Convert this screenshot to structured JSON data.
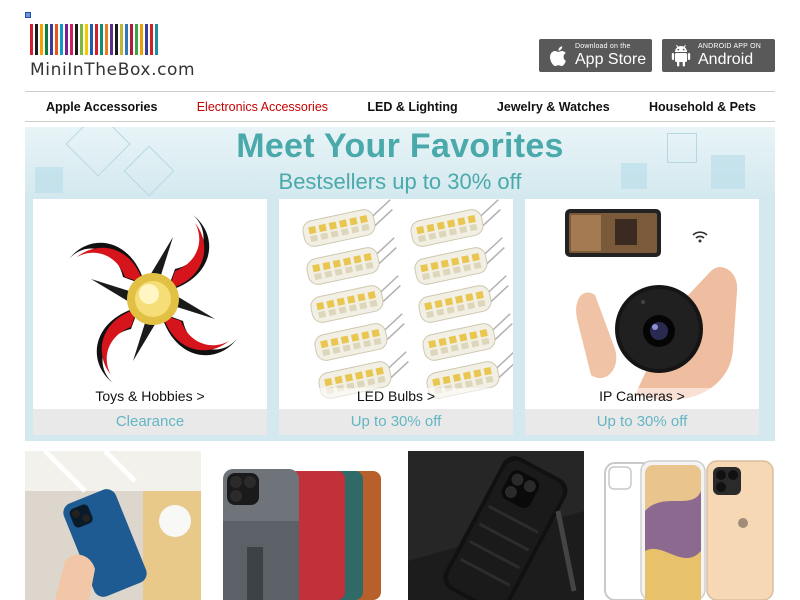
{
  "logo": {
    "text": "MiniInTheBox.com",
    "stripes": [
      "#d11f2e",
      "#1b1b1b",
      "#f3a200",
      "#0b7e3c",
      "#3b3b9c",
      "#e05a16",
      "#119ac9",
      "#7a1f8f",
      "#ce1f5b",
      "#1a1a1a",
      "#7cb93b",
      "#f2c800",
      "#1c5fa8",
      "#d11f2e",
      "#0f8d7c",
      "#e87b1e",
      "#5a2f8a",
      "#1b1b1b",
      "#c0b53a",
      "#2e7ab8",
      "#b3193b",
      "#3fa04a",
      "#e8a300",
      "#3b3b9c",
      "#cc2424",
      "#1c8ea3"
    ]
  },
  "badges": {
    "appstore": {
      "small": "Download on the",
      "big": "App Store",
      "icon": "apple-icon"
    },
    "android": {
      "small": "ANDROID APP ON",
      "big": "Android",
      "icon": "android-icon"
    }
  },
  "nav": {
    "items": [
      {
        "label": "Apple Accessories"
      },
      {
        "label": "Electronics Accessories"
      },
      {
        "label": "LED & Lighting"
      },
      {
        "label": "Jewelry & Watches"
      },
      {
        "label": "Household & Pets"
      }
    ],
    "active_index": 1
  },
  "banner": {
    "title": "Meet Your Favorites",
    "subtitle": "Bestsellers up to 30% off",
    "cards": [
      {
        "label": "Toys & Hobbies >",
        "promo": "Clearance",
        "image": "fidget-spinner"
      },
      {
        "label": "LED Bulbs >",
        "promo": "Up to 30% off",
        "image": "led-bulbs"
      },
      {
        "label": "IP Cameras >",
        "promo": "Up to 30% off",
        "image": "ip-camera"
      }
    ]
  },
  "products": [
    {
      "image": "blue-phone-case"
    },
    {
      "image": "leather-phone-cases"
    },
    {
      "image": "black-carbon-case"
    },
    {
      "image": "clear-phone-cases"
    }
  ],
  "colors": {
    "accent": "#4aa9aa",
    "active_nav": "#c40000",
    "badge_bg": "#595959",
    "banner_bg": "#d4e9ef"
  }
}
